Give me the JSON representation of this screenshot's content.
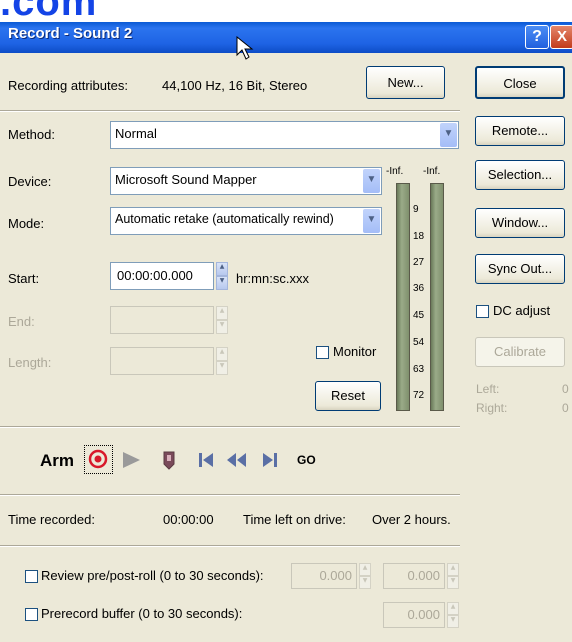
{
  "banner": {
    "text": ".com"
  },
  "window": {
    "title": "Record - Sound 2",
    "help_glyph": "?",
    "close_glyph": "X"
  },
  "attributes": {
    "label": "Recording attributes:",
    "value": "44,100 Hz, 16 Bit, Stereo",
    "new_button": "New..."
  },
  "side_buttons": {
    "close": "Close",
    "remote": "Remote...",
    "selection": "Selection...",
    "window": "Window...",
    "sync_out": "Sync Out...",
    "dc_adjust": "DC adjust",
    "calibrate": "Calibrate",
    "left_label": "Left:",
    "left_value": "0",
    "right_label": "Right:",
    "right_value": "0"
  },
  "form": {
    "method_label": "Method:",
    "method_value": "Normal",
    "device_label": "Device:",
    "device_value": "Microsoft Sound Mapper",
    "mode_label": "Mode:",
    "mode_value": "Automatic retake (automatically rewind)",
    "start_label": "Start:",
    "start_value": "00:00:00.000",
    "time_format": "hr:mn:sc.xxx",
    "end_label": "End:",
    "length_label": "Length:",
    "monitor_label": "Monitor",
    "reset_button": "Reset"
  },
  "meter": {
    "left_peak": "-Inf.",
    "right_peak": "-Inf.",
    "scale": [
      "9",
      "18",
      "27",
      "36",
      "45",
      "54",
      "63",
      "72"
    ]
  },
  "transport": {
    "arm_label": "Arm",
    "go_label": "GO"
  },
  "status": {
    "time_recorded_label": "Time recorded:",
    "time_recorded_value": "00:00:00",
    "time_left_label": "Time left on drive:",
    "time_left_value": "Over 2 hours."
  },
  "options": {
    "review_label": "Review pre/post-roll (0 to 30 seconds):",
    "review_pre_value": "0.000",
    "review_post_value": "0.000",
    "prerecord_label": "Prerecord buffer (0 to 30 seconds):",
    "prerecord_value": "0.000"
  },
  "colors": {
    "titlebar": "#1e63e4",
    "dialog_bg": "#ece9d8",
    "accent_red": "#d8192a"
  }
}
